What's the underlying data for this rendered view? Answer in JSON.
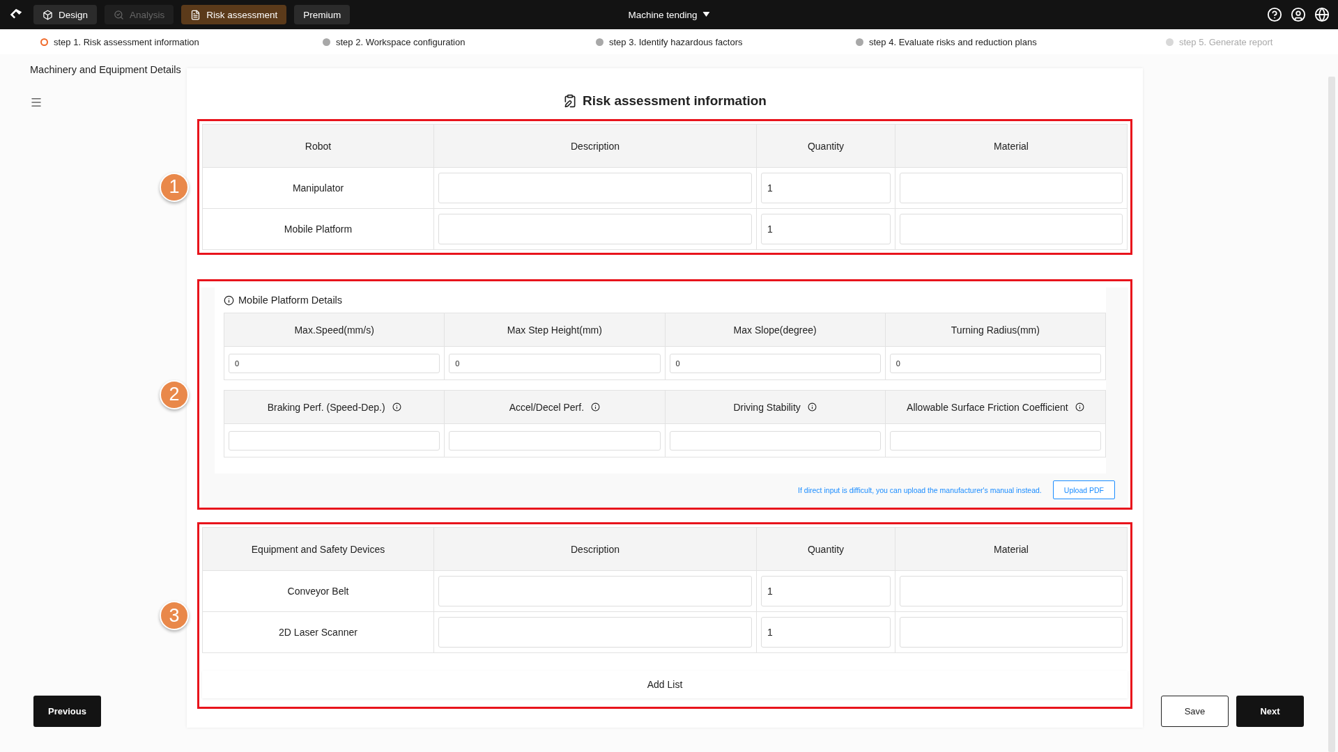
{
  "top_bar": {
    "tabs": [
      {
        "label": "Design",
        "selected": false,
        "disabled": false
      },
      {
        "label": "Analysis",
        "selected": false,
        "disabled": true
      },
      {
        "label": "Risk assessment",
        "selected": true,
        "disabled": false
      }
    ],
    "premium": "Premium",
    "project": "Machine tending"
  },
  "steps": [
    {
      "label": "step 1. Risk assessment information",
      "selected": true,
      "disabled": false
    },
    {
      "label": "step 2. Workspace configuration",
      "selected": false,
      "disabled": false
    },
    {
      "label": "step 3. Identify hazardous factors",
      "selected": false,
      "disabled": false
    },
    {
      "label": "step 4. Evaluate risks and reduction plans",
      "selected": false,
      "disabled": false
    },
    {
      "label": "step 5. Generate report",
      "selected": false,
      "disabled": true
    }
  ],
  "sidebar": {
    "title": "Machinery and Equipment Details"
  },
  "card": {
    "title": "Risk assessment information",
    "sections": [
      {
        "kind": "table",
        "marker": "1",
        "columns": [
          "Robot",
          "Description",
          "Quantity",
          "Material"
        ],
        "rows": [
          {
            "name": "Manipulator",
            "description": "",
            "quantity": "1",
            "material": ""
          },
          {
            "name": "Mobile Platform",
            "description": "",
            "quantity": "1",
            "material": ""
          }
        ]
      },
      {
        "kind": "details",
        "marker": "2",
        "title": "Mobile Platform Details",
        "groups": [
          {
            "columns": [
              {
                "label": "Max.Speed(mm/s)",
                "info": false,
                "value": "0"
              },
              {
                "label": "Max Step Height(mm)",
                "info": false,
                "value": "0"
              },
              {
                "label": "Max Slope(degree)",
                "info": false,
                "value": "0"
              },
              {
                "label": "Turning Radius(mm)",
                "info": false,
                "value": "0"
              }
            ]
          },
          {
            "columns": [
              {
                "label": "Braking Perf. (Speed-Dep.)",
                "info": true
              },
              {
                "label": "Accel/Decel Perf.",
                "info": true
              },
              {
                "label": "Driving Stability",
                "info": true
              },
              {
                "label": "Allowable Surface Friction Coefficient",
                "info": true
              }
            ]
          }
        ],
        "note": "If direct input is difficult, you can upload the manufacturer's manual instead.",
        "upload": "Upload PDF"
      },
      {
        "kind": "table",
        "marker": "3",
        "columns": [
          "Equipment and Safety Devices",
          "Description",
          "Quantity",
          "Material"
        ],
        "rows": [
          {
            "name": "Conveyor Belt",
            "description": "",
            "quantity": "1",
            "material": ""
          },
          {
            "name": "2D Laser Scanner",
            "description": "",
            "quantity": "1",
            "material": ""
          }
        ],
        "add": "Add List"
      }
    ]
  },
  "buttons": {
    "previous": "Previous",
    "save": "Save",
    "next": "Next"
  }
}
